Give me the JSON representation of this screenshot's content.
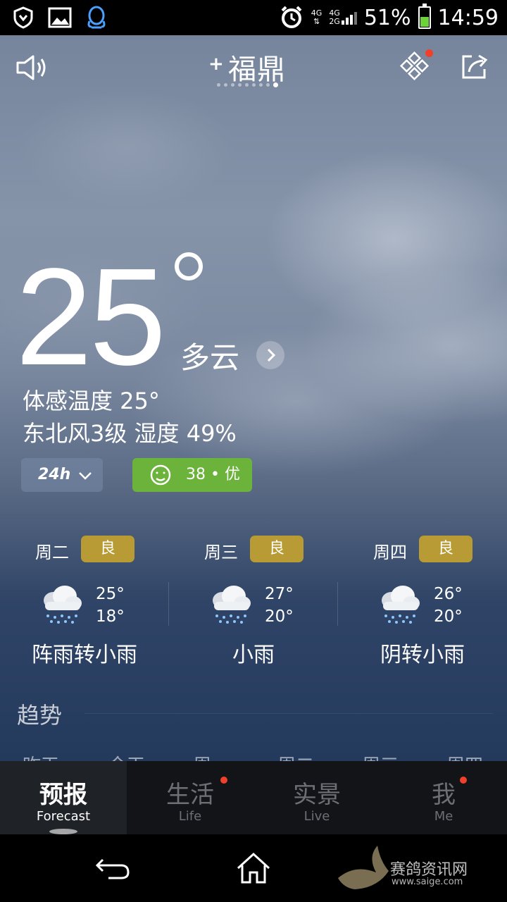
{
  "status_bar": {
    "net_top": "4G",
    "net_mid": "4G",
    "net_bot": "2G",
    "battery": "51%",
    "time": "14:59",
    "battery_level": 0.51
  },
  "header": {
    "city": "福鼎",
    "page_count": 9,
    "active_page": 9
  },
  "current": {
    "temperature": "25",
    "condition": "多云",
    "feels_like": "体感温度 25°",
    "wind_humidity": "东北风3级  湿度 49%",
    "hour_toggle": "24h",
    "aqi": "38 • 优"
  },
  "forecast": [
    {
      "day": "周二",
      "air": "良",
      "high": "25°",
      "low": "18°",
      "desc": "阵雨转小雨"
    },
    {
      "day": "周三",
      "air": "良",
      "high": "27°",
      "low": "20°",
      "desc": "小雨"
    },
    {
      "day": "周四",
      "air": "良",
      "high": "26°",
      "low": "20°",
      "desc": "阴转小雨"
    }
  ],
  "trend": {
    "title": "趋势",
    "days": [
      "昨天",
      "今天",
      "周一",
      "周二",
      "周三",
      "周四"
    ]
  },
  "tabs": [
    {
      "cn": "预报",
      "en": "Forecast"
    },
    {
      "cn": "生活",
      "en": "Life"
    },
    {
      "cn": "实景",
      "en": "Live"
    },
    {
      "cn": "我",
      "en": "Me"
    }
  ],
  "watermark": {
    "text": "赛鸽资讯网",
    "url": "www.saige.com"
  },
  "colors": {
    "aqi_green": "#6bb33a",
    "air_badge": "#b89b34",
    "notify_red": "#f0402a"
  }
}
